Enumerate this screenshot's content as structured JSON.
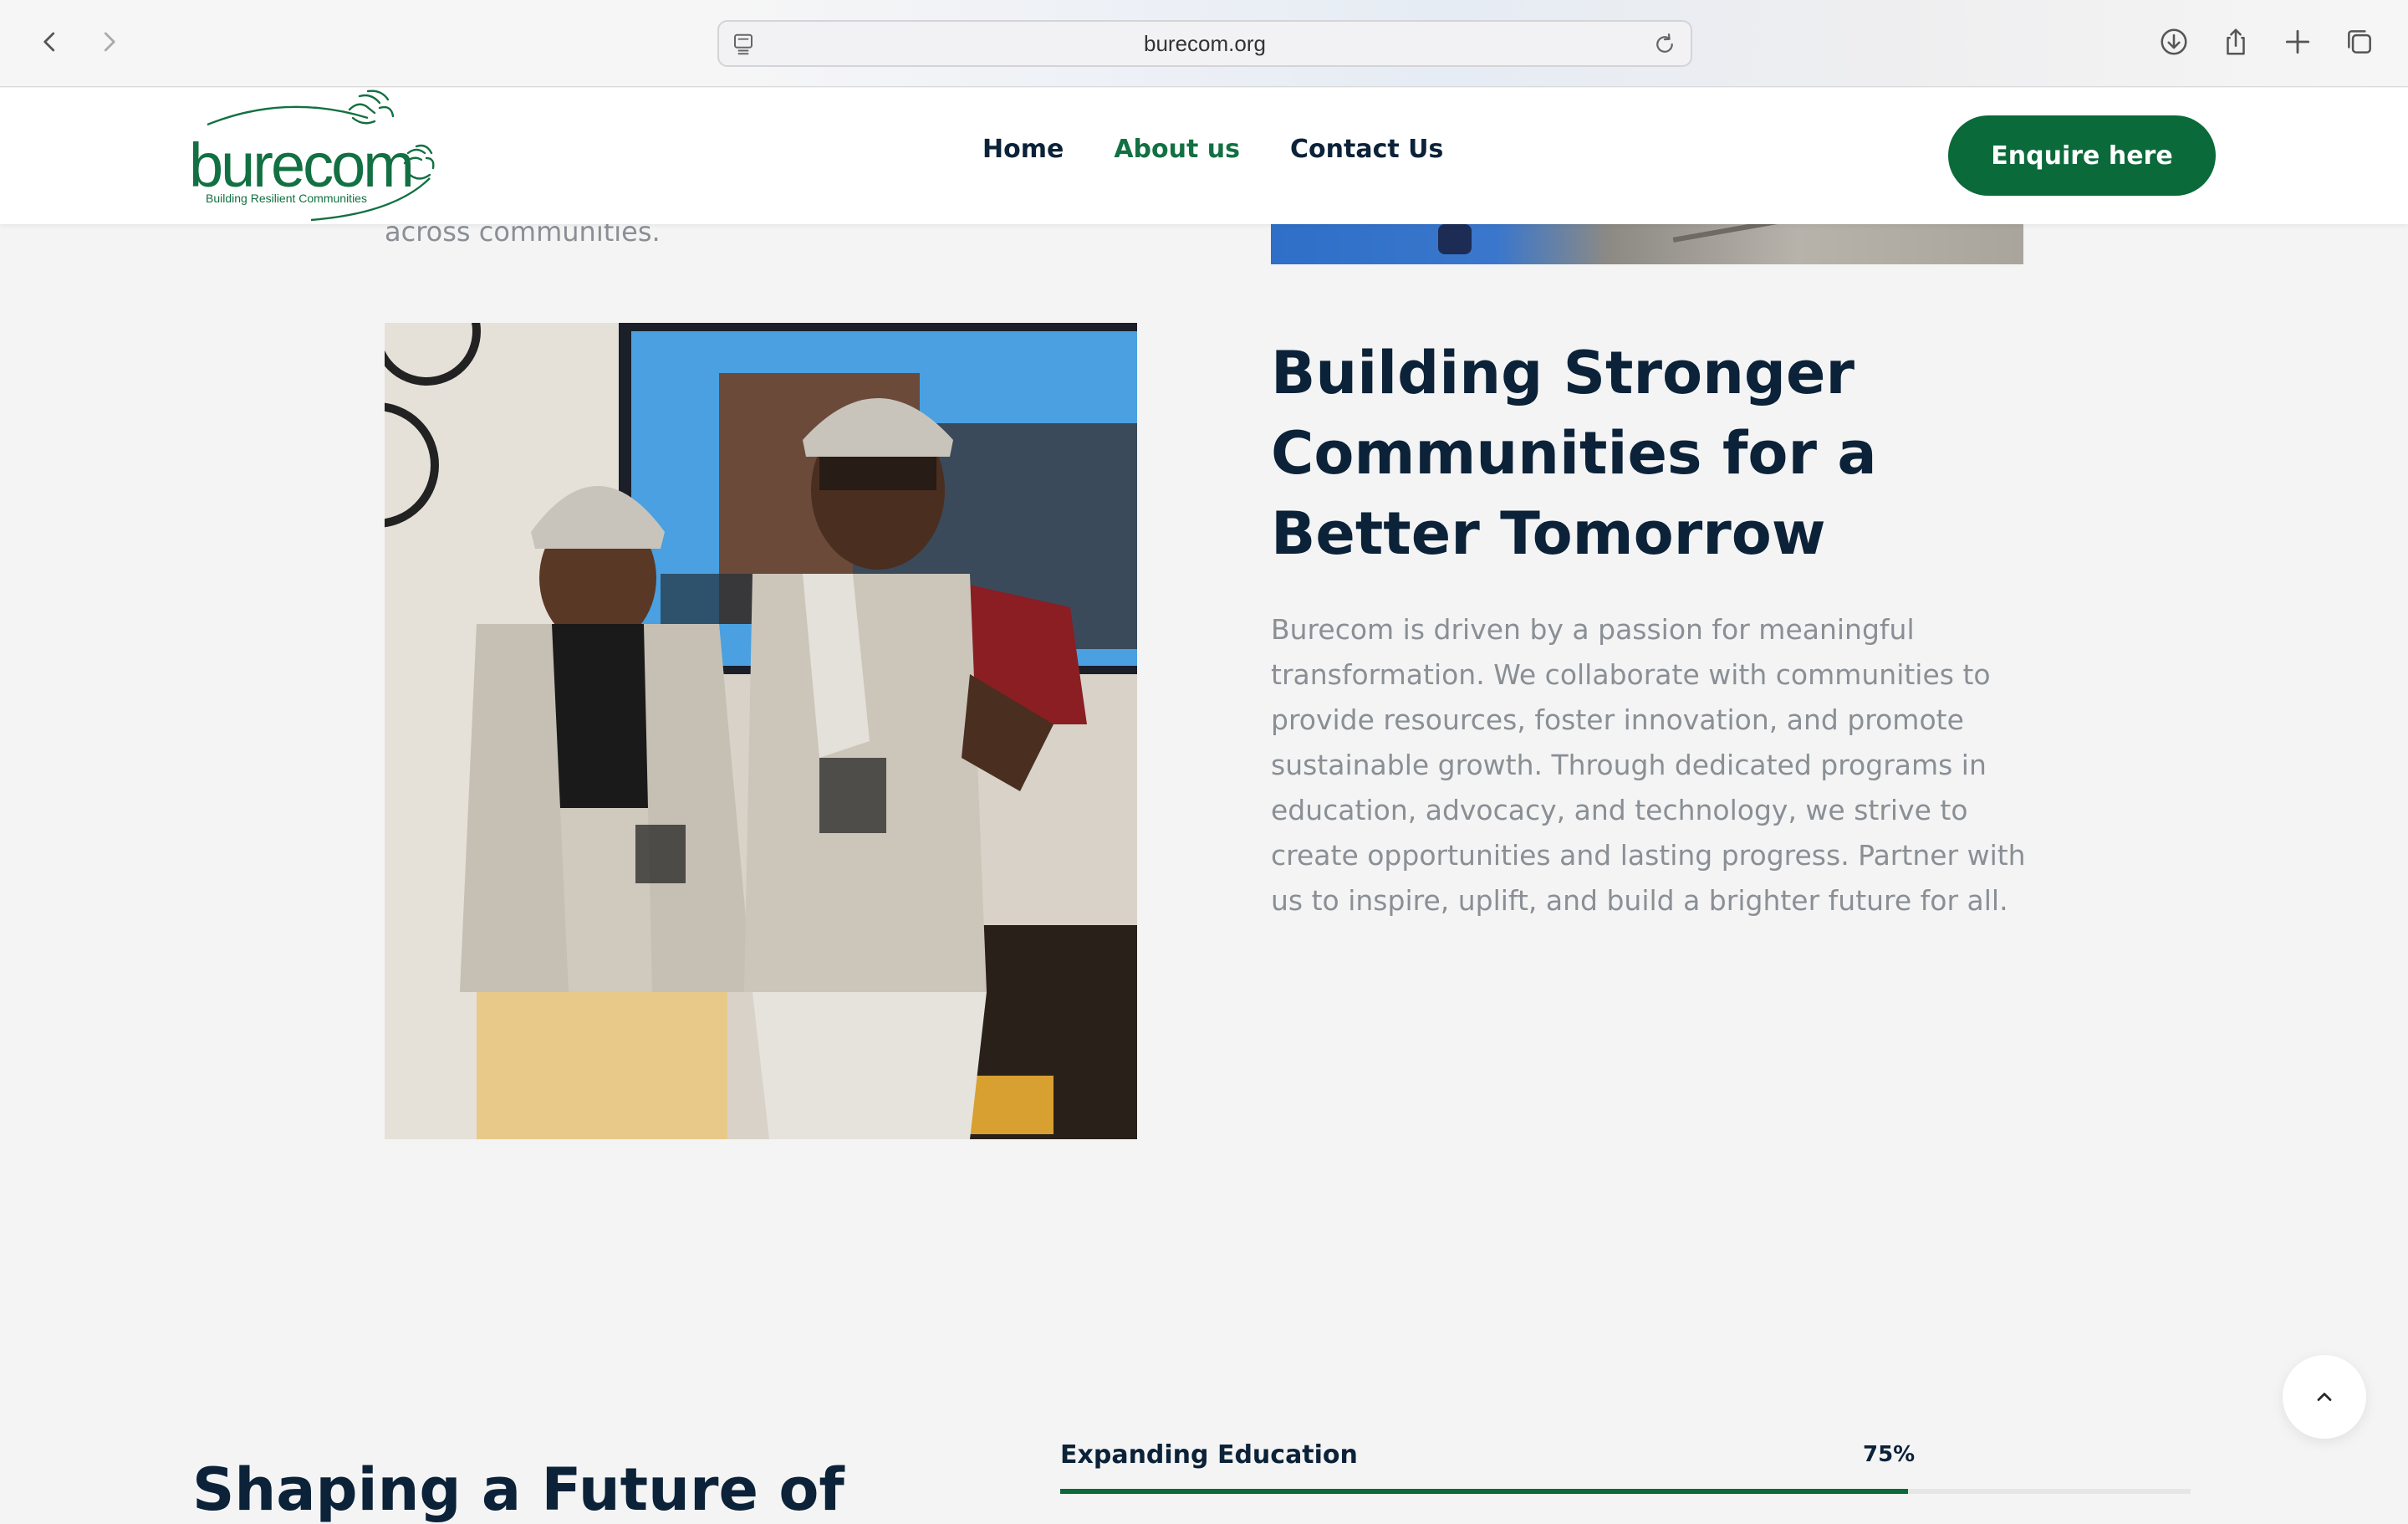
{
  "browser": {
    "url": "burecom.org",
    "icons": [
      "back-icon",
      "forward-icon",
      "page-icon",
      "reload-icon",
      "download-icon",
      "share-icon",
      "new-tab-icon",
      "tabs-overview-icon"
    ]
  },
  "header": {
    "logo_word": "burecom",
    "logo_tagline": "Building Resilient Communities",
    "nav": [
      {
        "label": "Home",
        "active": false
      },
      {
        "label": "About us",
        "active": true
      },
      {
        "label": "Contact Us",
        "active": false
      }
    ],
    "cta_label": "Enquire here"
  },
  "content": {
    "prev_paragraph_tail": "across communities.",
    "section_title": "Building Stronger Communities for a Better Tomorrow",
    "section_body": "Burecom is driven by a passion for meaningful transformation. We collaborate with communities to provide resources, foster innovation, and promote sustainable growth. Through dedicated programs in education, advocacy, and technology, we strive to create opportunities and lasting progress. Partner with us to inspire, uplift, and build a brighter future for all.",
    "shaping_title": "Shaping a Future of",
    "progress": {
      "label": "Expanding Education",
      "value_text": "75%",
      "value": 75
    }
  },
  "colors": {
    "brand_green": "#0a6a3a",
    "heading": "#0b2239",
    "body_text": "#8a8f95",
    "page_bg": "#f4f4f4"
  }
}
